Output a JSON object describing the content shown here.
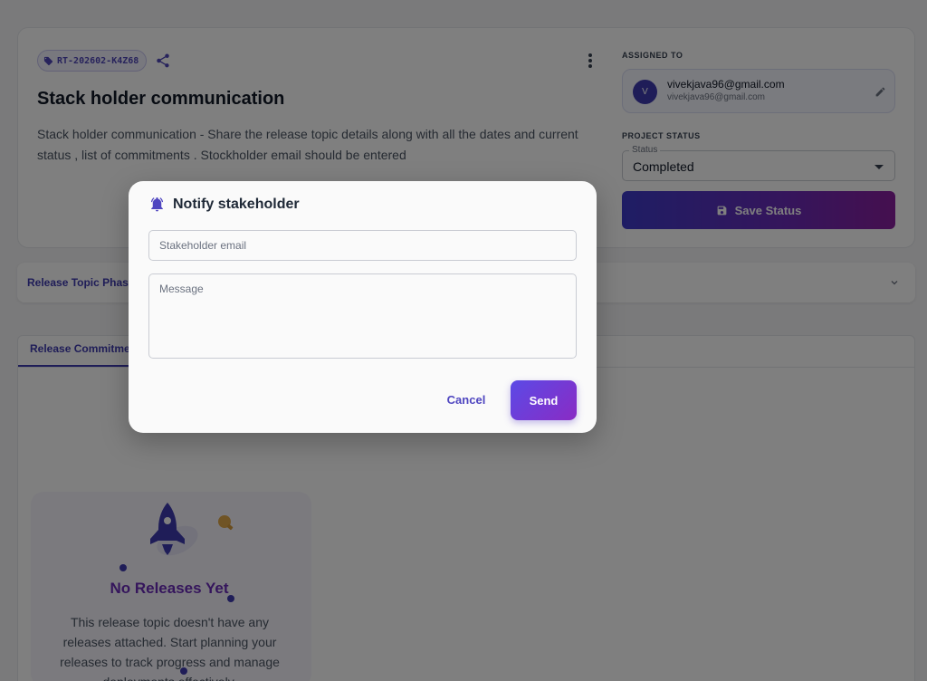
{
  "release": {
    "tag": "RT-202602-K4Z68",
    "title": "Stack holder communication",
    "description": "Stack holder communication - Share the release topic details along with all the dates and current status , list of commitments . Stockholder email should be entered"
  },
  "assigned": {
    "label": "ASSIGNED TO",
    "avatar_initial": "V",
    "name": "vivekjava96@gmail.com",
    "email": "vivekjava96@gmail.com"
  },
  "project_status": {
    "label": "PROJECT STATUS",
    "field_label": "Status",
    "value": "Completed",
    "save_label": "Save Status"
  },
  "accordion": {
    "label": "Release Topic Phas"
  },
  "tabs": {
    "active": "Release Commitme",
    "second": "",
    "third": ""
  },
  "empty_state": {
    "title": "No Releases Yet",
    "text": "This release topic doesn't have any releases attached. Start planning your releases to track progress and manage deployments effectively."
  },
  "dialog": {
    "title": "Notify stakeholder",
    "email_placeholder": "Stakeholder email",
    "message_placeholder": "Message",
    "cancel_label": "Cancel",
    "send_label": "Send"
  },
  "colors": {
    "accent": "#3f3bb0",
    "gradient_end": "#8a2bc4"
  },
  "icons": [
    "tag-icon",
    "share-icon",
    "more-vert-icon",
    "edit-icon",
    "save-icon",
    "chevron-down-icon",
    "rocket-icon",
    "bulb-icon",
    "notification-bell-icon"
  ]
}
